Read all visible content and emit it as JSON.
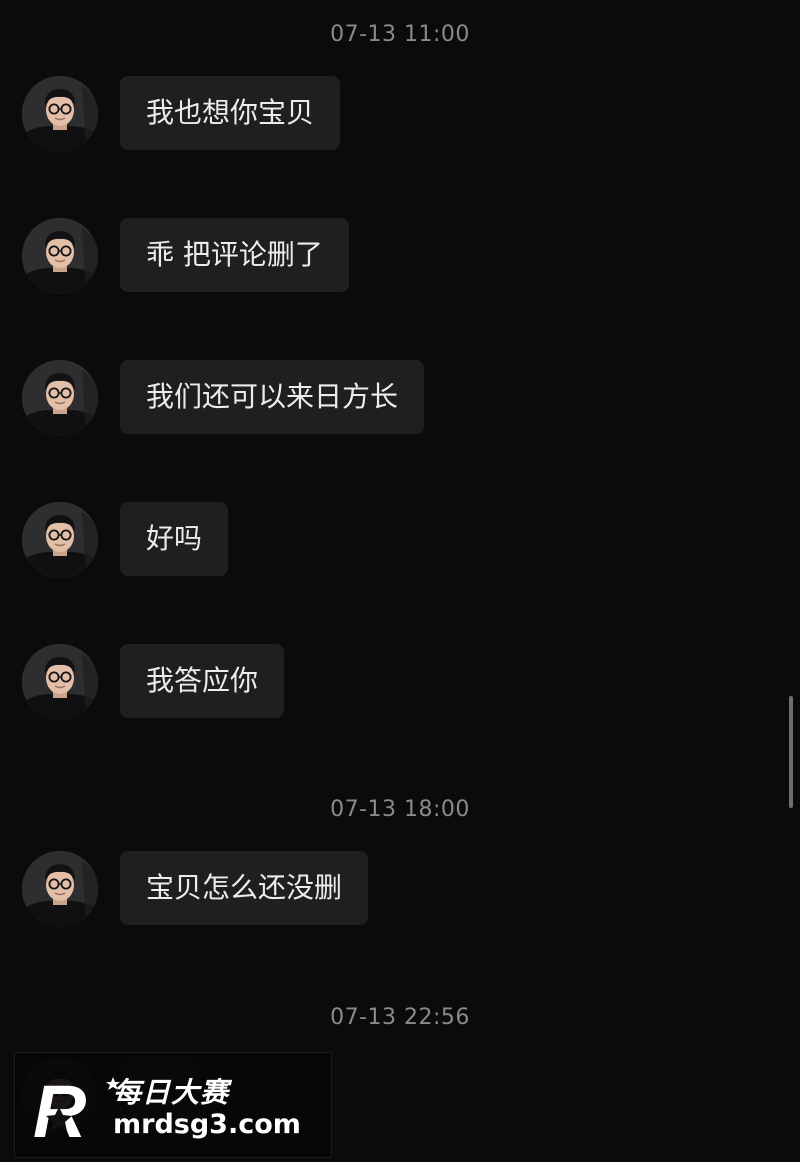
{
  "timestamps": [
    "07-13 11:00",
    "07-13 18:00",
    "07-13 22:56"
  ],
  "messages": [
    {
      "text": "我也想你宝贝"
    },
    {
      "text": "乖 把评论删了"
    },
    {
      "text": "我们还可以来日方长"
    },
    {
      "text": "好吗"
    },
    {
      "text": "我答应你"
    },
    {
      "text": "宝贝怎么还没删"
    },
    {
      "text": ""
    }
  ],
  "watermark": {
    "logo_letter": "R",
    "brand_cn": "每日大赛",
    "url": "mrdsg3.com"
  },
  "colors": {
    "background": "#0b0b0c",
    "bubble": "#1f1f21",
    "text": "#ececec",
    "timestamp": "#8a8a8e"
  }
}
